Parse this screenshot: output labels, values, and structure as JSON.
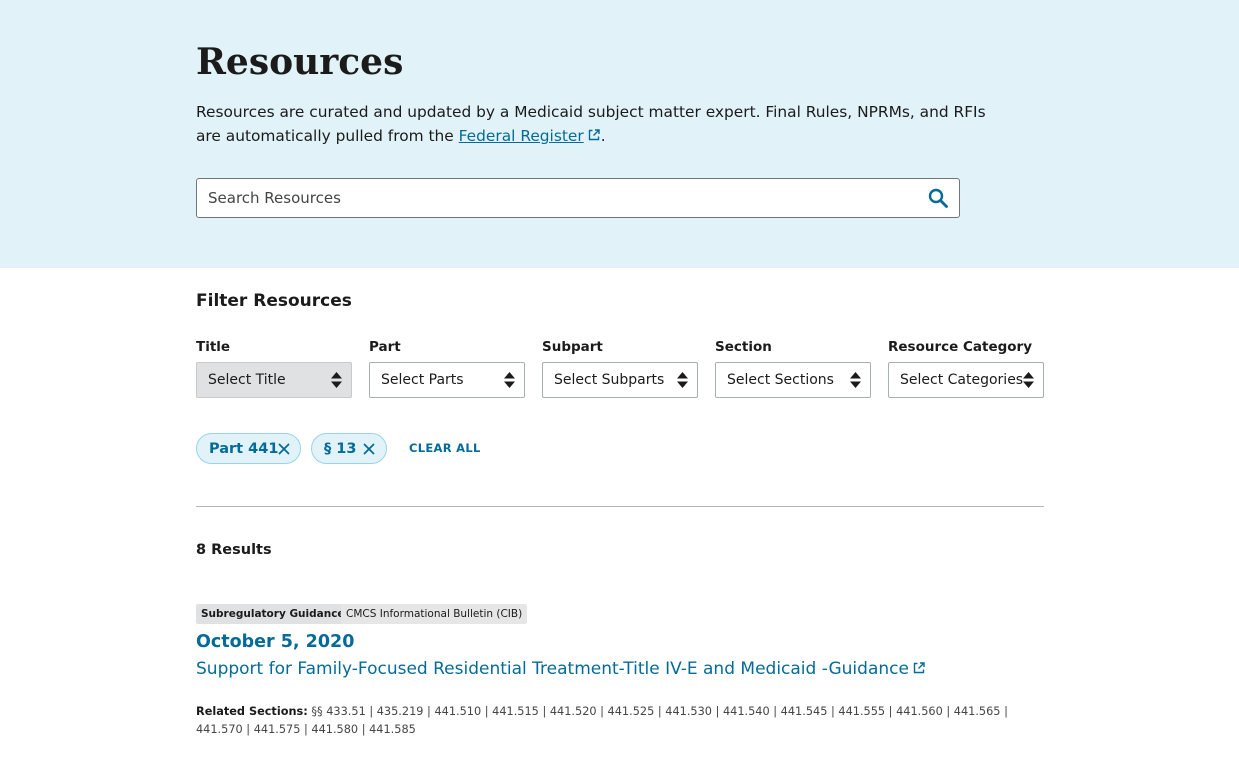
{
  "hero": {
    "title": "Resources",
    "intro_before": "Resources are curated and updated by a Medicaid subject matter expert. Final Rules, NPRMs, and RFIs are automatically pulled from the ",
    "intro_link": "Federal Register",
    "intro_after": ".",
    "search_placeholder": "Search Resources",
    "search_icon": "search-icon",
    "background_color": "#e1f3f8"
  },
  "filters": {
    "heading": "Filter Resources",
    "fields": [
      {
        "label": "Title",
        "value": "Select Title",
        "disabled": true
      },
      {
        "label": "Part",
        "value": "Select Parts",
        "disabled": false
      },
      {
        "label": "Subpart",
        "value": "Select Subparts",
        "disabled": false
      },
      {
        "label": "Section",
        "value": "Select Sections",
        "disabled": false
      },
      {
        "label": "Resource Category",
        "value": "Select Categories",
        "disabled": false
      }
    ],
    "active_chips": [
      {
        "label": "Part 441"
      },
      {
        "label": "§ 13"
      }
    ],
    "clear_all": "CLEAR ALL"
  },
  "results": {
    "count_label": "8 Results",
    "items": [
      {
        "badges": [
          "Subregulatory Guidance",
          "CMCS Informational Bulletin (CIB)"
        ],
        "date": "October 5, 2020",
        "title": "Support for Family-Focused Residential Treatment-Title IV-E and Medicaid -Guidance",
        "related_label": "Related Sections:",
        "related_sections": "§§ 433.51 | 435.219 | 441.510 | 441.515 | 441.520 | 441.525 | 441.530 | 441.540 | 441.545 | 441.555 | 441.560 | 441.565 | 441.570 | 441.575 | 441.580 | 441.585"
      }
    ]
  },
  "colors": {
    "link": "#046b99",
    "chip_background": "#e1f3f8",
    "chip_border": "#97d4ea"
  }
}
